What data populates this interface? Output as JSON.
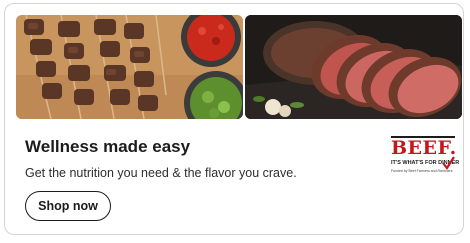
{
  "promo": {
    "title": "Wellness made easy",
    "subtitle": "Get the nutrition you need & the flavor you crave.",
    "cta_label": "Shop now"
  },
  "logo": {
    "wordmark": "BEEF.",
    "tagline": "IT'S WHAT'S FOR DINNER",
    "fine_print": "Funded by Beef Farmers and Ranchers"
  },
  "images": {
    "left": "beef kabob skewers with red salsa and microgreens",
    "right": "sliced roast beef on a cutting board"
  },
  "colors": {
    "brand_red": "#c4161c",
    "text": "#1c1c1c",
    "border": "#d4d4d4"
  }
}
